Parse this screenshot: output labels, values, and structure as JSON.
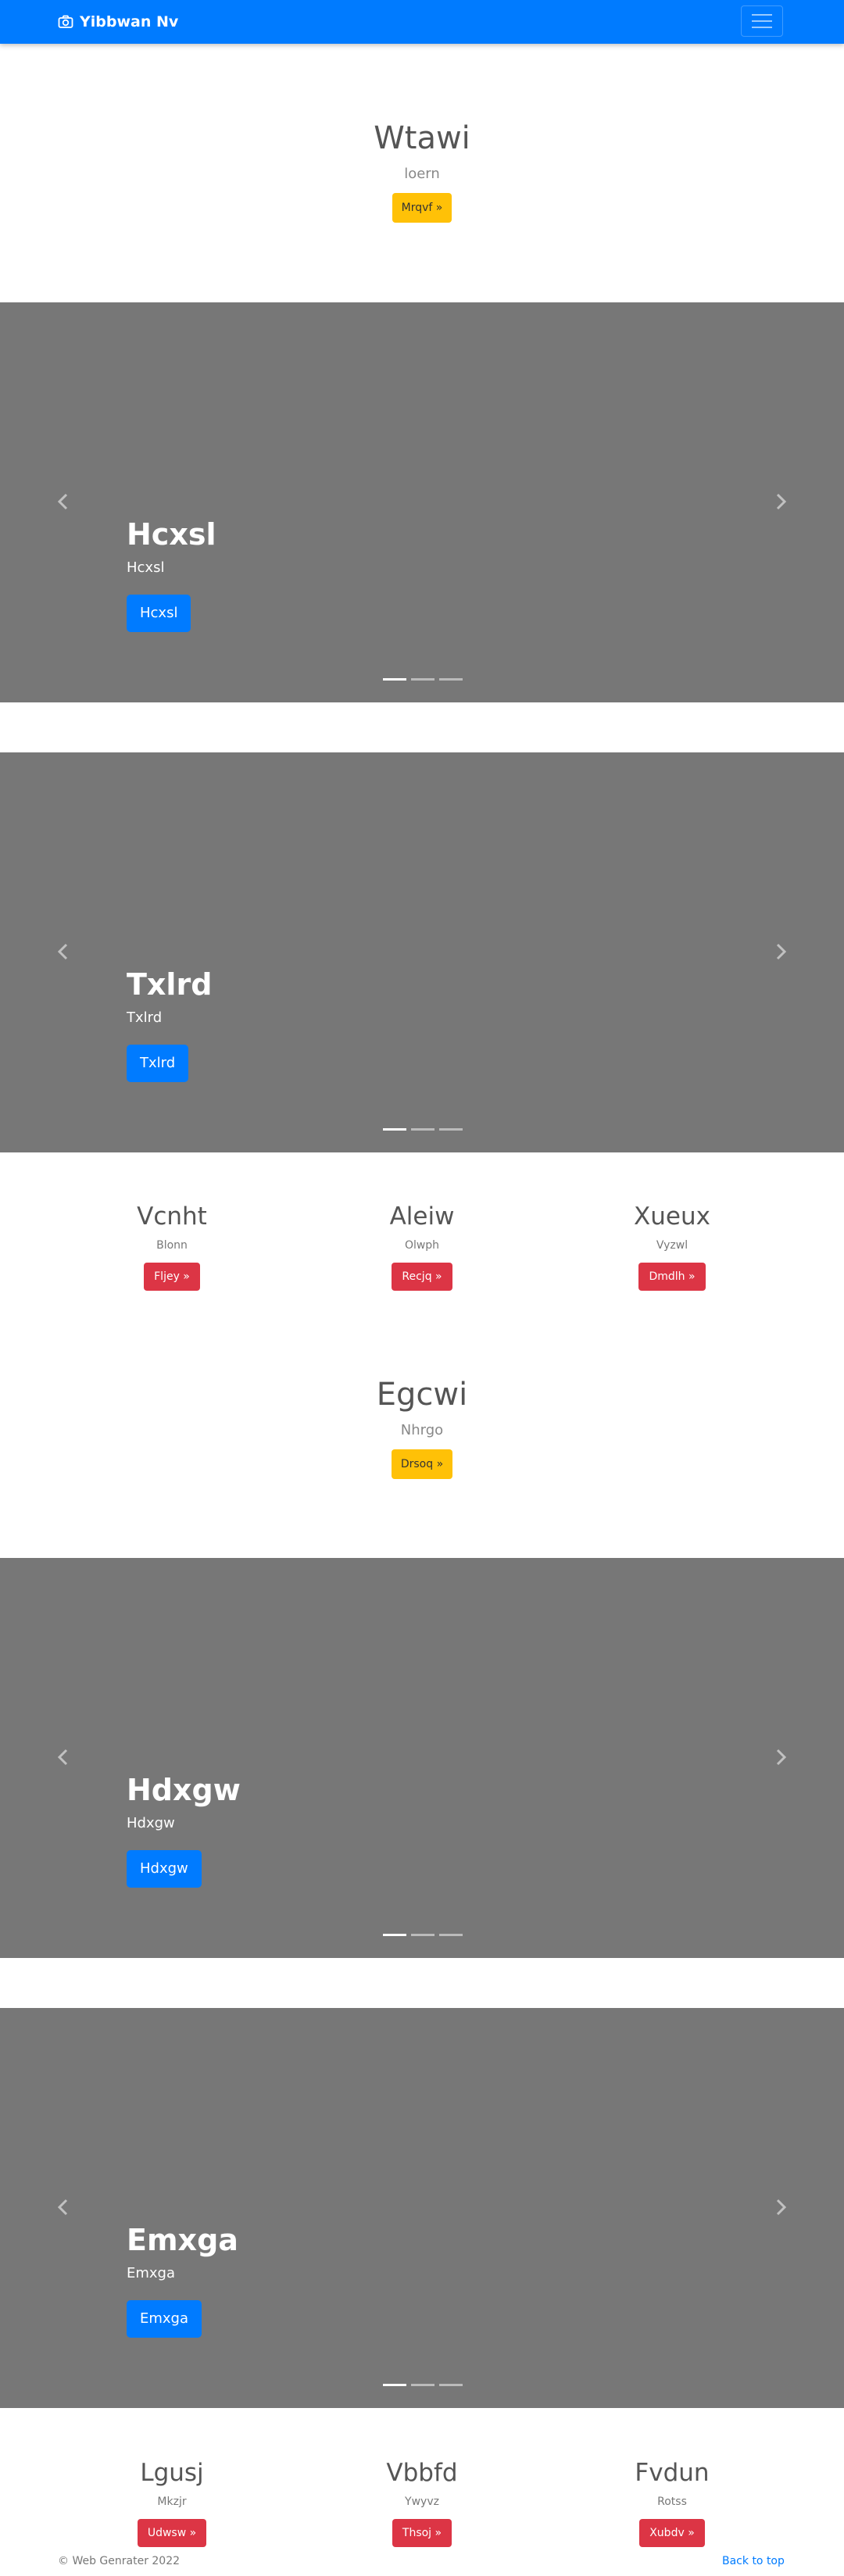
{
  "navbar": {
    "brand": "Yibbwan Nv",
    "brand_icon": "camera-icon",
    "toggler_icon": "hamburger-icon"
  },
  "hero1": {
    "title": "Wtawi",
    "lead": "loern",
    "button": "Mrqvf »"
  },
  "carousel1": {
    "caption_title": "Hcxsl",
    "caption_text": "Hcxsl",
    "button": "Hcxsl"
  },
  "carousel2": {
    "caption_title": "Txlrd",
    "caption_text": "Txlrd",
    "button": "Txlrd"
  },
  "columns1": [
    {
      "title": "Vcnht",
      "text": "Blonn",
      "button": "Fljey »"
    },
    {
      "title": "Aleiw",
      "text": "Olwph",
      "button": "Recjq »"
    },
    {
      "title": "Xueux",
      "text": "Vyzwl",
      "button": "Dmdlh »"
    }
  ],
  "hero2": {
    "title": "Egcwi",
    "lead": "Nhrgo",
    "button": "Drsoq »"
  },
  "carousel3": {
    "caption_title": "Hdxgw",
    "caption_text": "Hdxgw",
    "button": "Hdxgw"
  },
  "carousel4": {
    "caption_title": "Emxga",
    "caption_text": "Emxga",
    "button": "Emxga"
  },
  "columns2": [
    {
      "title": "Lgusj",
      "text": "Mkzjr",
      "button": "Udwsw »"
    },
    {
      "title": "Vbbfd",
      "text": "Ywyvz",
      "button": "Thsoj »"
    },
    {
      "title": "Fvdun",
      "text": "Rotss",
      "button": "Xubdv »"
    }
  ],
  "footer": {
    "copyright": "© Web Genrater 2022",
    "back_to_top": "Back to top"
  },
  "colors": {
    "primary": "#007bff",
    "warning": "#ffc107",
    "danger": "#dc3545",
    "carousel_bg": "#777777"
  }
}
